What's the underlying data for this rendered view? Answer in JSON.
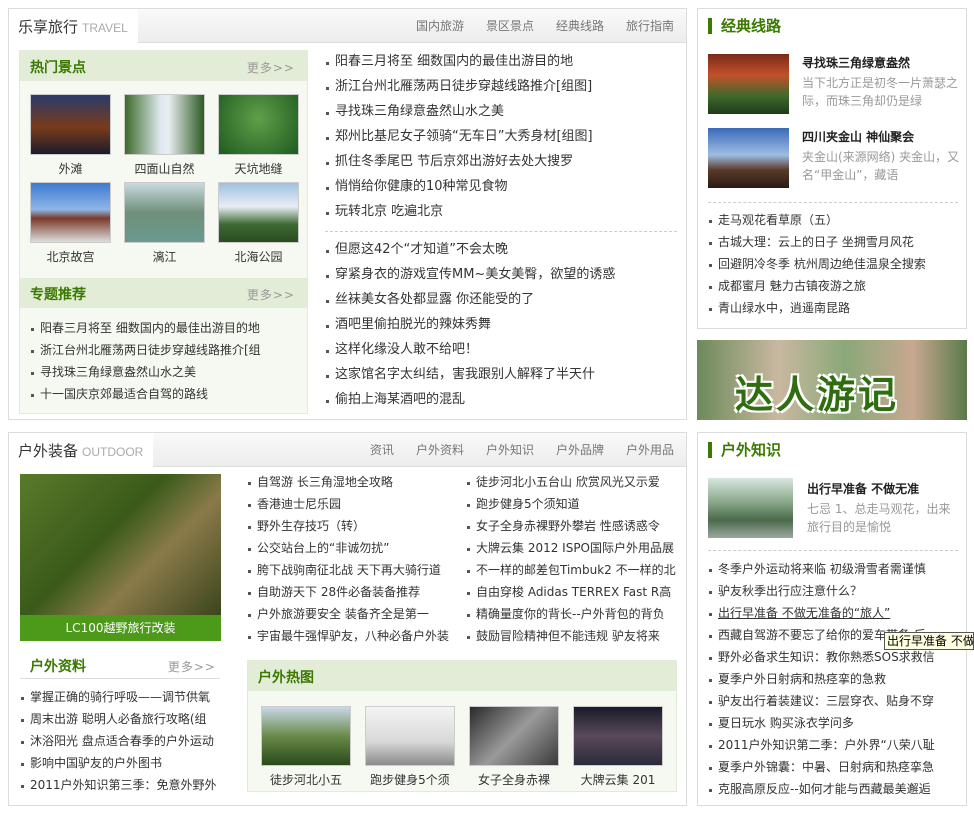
{
  "travel": {
    "title": "乐享旅行",
    "title_en": "TRAVEL",
    "nav": [
      "国内旅游",
      "景区景点",
      "经典线路",
      "旅行指南"
    ],
    "hot": {
      "title": "热门景点",
      "more": "更多>>",
      "items": [
        "外滩",
        "四面山自然",
        "天坑地缝",
        "北京故宫",
        "漓江",
        "北海公园"
      ]
    },
    "special": {
      "title": "专题推荐",
      "more": "更多>>",
      "items": [
        "阳春三月将至  细数国内的最佳出游目的地",
        "浙江台州北雁荡两日徒步穿越线路推介[组",
        "寻找珠三角绿意盎然山水之美",
        "十一国庆京郊最适合自驾的路线"
      ]
    },
    "news1": [
      "阳春三月将至  细数国内的最佳出游目的地",
      "浙江台州北雁荡两日徒步穿越线路推介[组图]",
      "寻找珠三角绿意盎然山水之美",
      "郑州比基尼女子领骑“无车日”大秀身材[组图]",
      "抓住冬季尾巴  节后京郊出游好去处大搜罗",
      "悄悄给你健康的10种常见食物",
      "玩转北京  吃遍北京"
    ],
    "news2": [
      "但愿这42个“才知道”不会太晚",
      "穿紧身衣的游戏宣传MM~美女美臀，欲望的诱惑",
      "丝袜美女各处都显露  你还能受的了",
      "酒吧里偷拍脱光的辣妹秀舞",
      "这样化缘没人敢不给吧！",
      "这家馆名字太纠结，害我跟别人解释了半天什",
      "偷拍上海某酒吧的混乱"
    ]
  },
  "classic": {
    "title": "经典线路",
    "features": [
      {
        "title": "寻找珠三角绿意盎然",
        "desc": "当下北方正是初冬一片萧瑟之际，而珠三角却仍是绿"
      },
      {
        "title": "四川夹金山  神仙聚会",
        "desc": "夹金山(来源网络) 夹金山，又名“甲金山”，藏语"
      }
    ],
    "items": [
      "走马观花看草原（五）",
      "古城大理：云上的日子  坐拥雪月风花",
      "回避阴冷冬季  杭州周边绝佳温泉全搜索",
      "成都蜜月  魅力古镇夜游之旅",
      "青山绿水中，逍遥南昆路"
    ]
  },
  "banner": {
    "text": "达人游记"
  },
  "outdoor": {
    "title": "户外装备",
    "title_en": "OUTDOOR",
    "nav": [
      "资讯",
      "户外资料",
      "户外知识",
      "户外品牌",
      "户外用品"
    ],
    "photo_caption": "LC100越野旅行改装",
    "col1": [
      "自驾游  长三角湿地全攻略",
      "香港迪士尼乐园",
      "野外生存技巧（转）",
      "公交站台上的“非诚勿扰”",
      "胯下战驹南征北战  天下再大骑行道",
      "自助游天下  28件必备装备推荐",
      "户外旅游要安全  装备齐全是第一",
      "宇宙最牛强悍驴友，八种必备户外装"
    ],
    "col2": [
      "徒步河北小五台山  欣赏风光又示爱",
      "跑步健身5个须知道",
      "女子全身赤裸野外攀岩  性感诱惑令",
      "大牌云集  2012 ISPO国际户外用品展",
      "不一样的邮差包Timbuk2  不一样的北",
      "自由穿梭  Adidas TERREX Fast R高",
      "精确量度你的背长--户外背包的背负",
      "鼓励冒险精神但不能违规  驴友将来"
    ],
    "info": {
      "title": "户外资料",
      "more": "更多>>",
      "items": [
        "掌握正确的骑行呼吸——调节供氧",
        "周末出游  聪明人必备旅行攻略(组",
        "沐浴阳光  盘点适合春季的户外运动",
        "影响中国驴友的户外图书",
        "2011户外知识第三季：免意外野外"
      ]
    },
    "hotpics": {
      "title": "户外热图",
      "items": [
        "徒步河北小五",
        "跑步健身5个须",
        "女子全身赤裸",
        "大牌云集  201"
      ]
    }
  },
  "knowledge": {
    "title": "户外知识",
    "feature": {
      "title": "出行早准备  不做无准",
      "desc": "七忌    1、总走马观花，出来旅行目的是愉悦"
    },
    "items": [
      "冬季户外运动将来临  初级滑雪者需谨慎",
      "驴友秋季出行应注意什么？",
      "出行早准备  不做无准备的“旅人”",
      "西藏自驾游不要忘了给你的爱车带备  后",
      "野外必备求生知识：教你熟悉SOS求救信",
      "夏季户外日射病和热痉挛的急救",
      "驴友出行着装建议：三层穿衣、贴身不穿",
      "夏日玩水  购买泳衣学问多",
      "2011户外知识第二季：户外界“八荣八耻",
      "夏季户外锦囊：中暑、日射病和热痉挛急",
      "克服高原反应--如何才能与西藏最美邂逅"
    ],
    "tooltip": "出行早准备  不做"
  }
}
